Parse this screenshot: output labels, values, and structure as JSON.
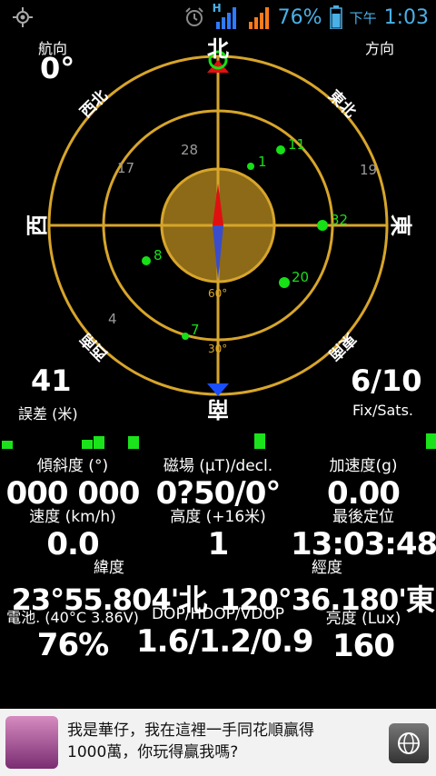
{
  "statusbar": {
    "network_h": "H",
    "battery_pct": "76%",
    "ampm": "下午",
    "time": "1:03"
  },
  "compass": {
    "heading_label": "航向",
    "heading_value": "0°",
    "direction_label": "方向",
    "dirs": {
      "n": "北",
      "s": "南",
      "e": "東",
      "w": "西",
      "ne": "東北",
      "nw": "西北",
      "se": "東南",
      "sw": "西南"
    },
    "ring_labels": [
      "60°",
      "30°"
    ],
    "satellites_used": [
      "1",
      "11",
      "32",
      "20",
      "8",
      "7"
    ],
    "satellites_unused": [
      "28",
      "17",
      "19",
      "4"
    ],
    "error_value": "41",
    "error_label": "誤差 (米)",
    "fix_value": "6/10",
    "fix_label": "Fix/Sats.",
    "colors": {
      "ring": "#d7a52a",
      "center": "#8c6a18",
      "used": "#16e016",
      "unused": "#9a9a9a",
      "north_marker": "#e01010",
      "south_marker": "#1a4fff"
    }
  },
  "signal_bars": [
    9,
    0,
    0,
    0,
    0,
    0,
    0,
    10,
    14,
    0,
    0,
    14,
    0,
    0,
    0,
    0,
    0,
    0,
    0,
    0,
    0,
    0,
    17,
    0,
    0,
    0,
    0,
    0,
    0,
    0,
    0,
    0,
    0,
    0,
    0,
    0,
    0,
    17
  ],
  "stats": {
    "tilt_label": "傾斜度 (°)",
    "tilt_value": "000 000",
    "mag_label": "磁場 (µT)/decl.",
    "mag_value": "0?50/0°",
    "accel_label": "加速度(g)",
    "accel_value": "0.00",
    "speed_label": "速度 (km/h)",
    "speed_value": "0.0",
    "alt_label": "高度 (+16米)",
    "alt_value": "1",
    "lastfix_label": "最後定位",
    "lastfix_value": "13:03:48",
    "lat_label": "緯度",
    "lat_value": "23°55.804'北",
    "lon_label": "經度",
    "lon_value": "120°36.180'東",
    "battery_label": "電池. (40°C 3.86V)",
    "battery_value": "76%",
    "dop_label": "DOP/HDOP/VDOP",
    "dop_value": "1.6/1.2/0.9",
    "lux_label": "亮度 (Lux)",
    "lux_value": "160"
  },
  "ad": {
    "line1": "我是華仔，我在這裡一手同花順贏得",
    "line2": "1000萬，你玩得贏我嗎?"
  }
}
